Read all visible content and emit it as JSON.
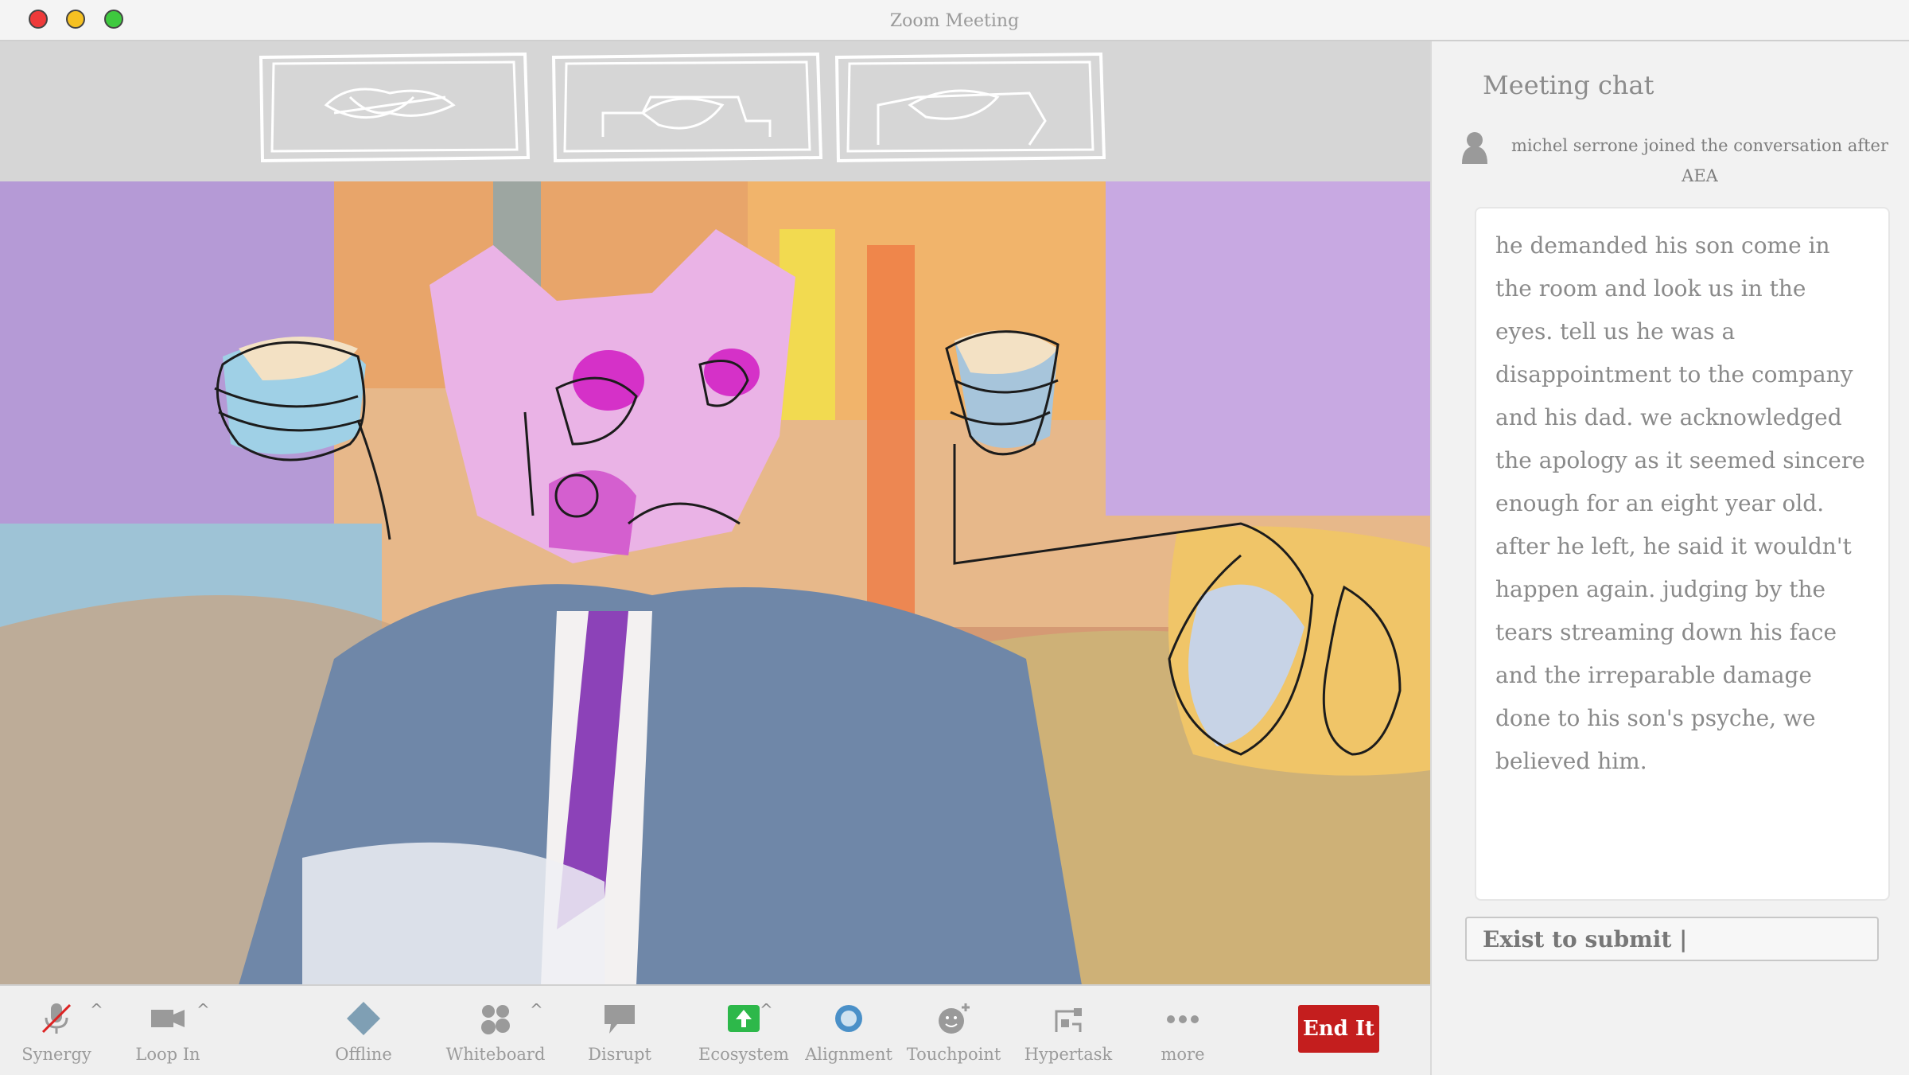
{
  "window": {
    "title": "Zoom Meeting"
  },
  "chat": {
    "title": "Meeting chat",
    "join_notice": "michel serrone  joined the conversation after AEA",
    "message": "he demanded his son come in the room and look us in the eyes. tell us he was a disappointment to the company and his dad. we acknowledged the apology as it seemed sincere enough for an eight year old. after he left, he said it wouldn't happen again. judging by the tears streaming down his face and the irreparable damage done to his son's psyche, we believed him.",
    "input_value": "Exist to submit |"
  },
  "toolbar": {
    "items": [
      {
        "label": "Synergy",
        "icon": "muted-microphone-icon"
      },
      {
        "label": "Loop In",
        "icon": "video-camera-icon"
      },
      {
        "label": "Offline",
        "icon": "diamond-icon"
      },
      {
        "label": "Whiteboard",
        "icon": "participants-icon"
      },
      {
        "label": "Disrupt",
        "icon": "speech-bubble-icon"
      },
      {
        "label": "Ecosystem",
        "icon": "share-screen-icon"
      },
      {
        "label": "Alignment",
        "icon": "circle-record-icon"
      },
      {
        "label": "Touchpoint",
        "icon": "smiley-plus-icon"
      },
      {
        "label": "Hypertask",
        "icon": "apps-icon"
      },
      {
        "label": "more",
        "icon": "more-dots-icon"
      }
    ],
    "end_label": "End It"
  },
  "colors": {
    "end_button": "#c41e1e",
    "ecosystem_icon": "#2db84a",
    "alignment_icon": "#4a90c8",
    "traffic_red": "#ee3a3a",
    "traffic_yellow": "#f6c122",
    "traffic_green": "#3ec93e"
  }
}
